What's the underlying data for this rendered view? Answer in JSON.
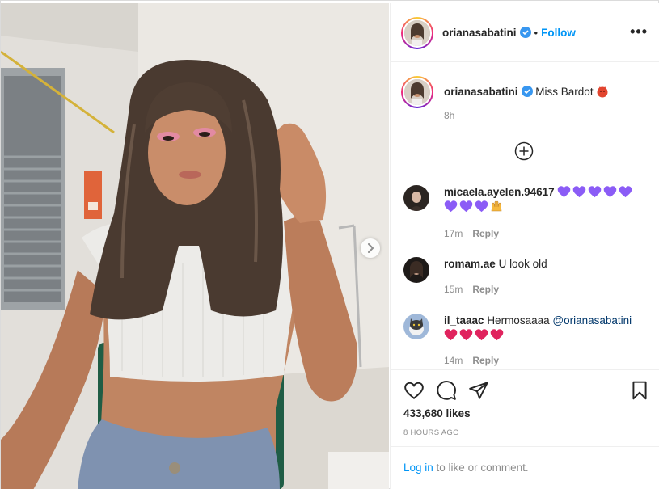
{
  "post": {
    "author": "orianasabatini",
    "follow_label": "Follow",
    "separator": "•",
    "more_label": "•••",
    "caption": "Miss Bardot",
    "caption_time": "8h",
    "likes": "433,680 likes",
    "time_ago": "8 HOURS AGO"
  },
  "comments": [
    {
      "user": "micaela.ayelen.94617",
      "hearts_line1": 5,
      "hearts_line2": 3,
      "heart_color": "#8b5cf6",
      "extra_emoji": "raising-hands",
      "time": "17m",
      "reply": "Reply"
    },
    {
      "user": "romam.ae",
      "text": "U look old",
      "time": "15m",
      "reply": "Reply"
    },
    {
      "user": "il_taaac",
      "text": "Hermosaaaa",
      "mention": "@orianasabatini",
      "hearts": 4,
      "heart_color": "#e0245e",
      "time": "14m",
      "reply": "Reply"
    }
  ],
  "login": {
    "link": "Log in",
    "rest": " to like or comment."
  },
  "icons": {
    "verified": "verified-badge-icon",
    "next": "chevron-right-icon",
    "load_more": "plus-circle-icon",
    "like": "heart-icon",
    "comment": "comment-bubble-icon",
    "share": "paper-plane-icon",
    "save": "bookmark-icon"
  },
  "colors": {
    "accent": "#0095f6",
    "muted": "#8e8e8e",
    "verified": "#3897f0",
    "border": "#efefef"
  }
}
